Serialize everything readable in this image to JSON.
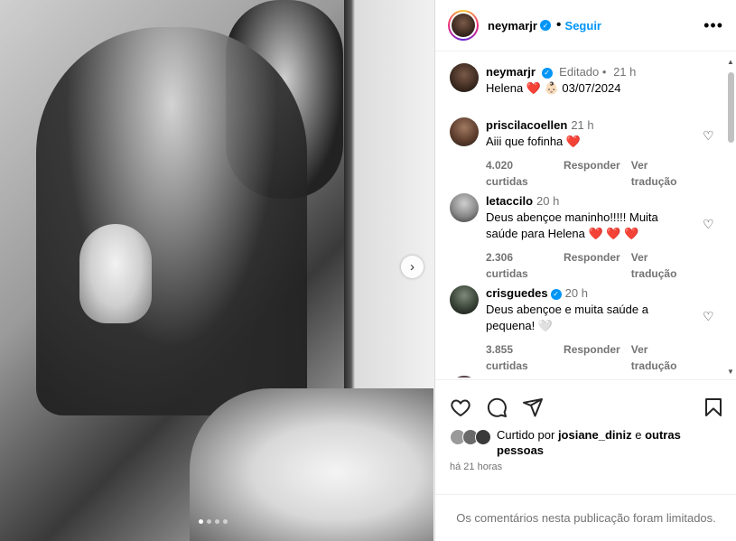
{
  "post": {
    "author": "neymarjr",
    "follow_label": "Seguir",
    "separator": "•",
    "more_label": "•••",
    "next_label": "›",
    "carousel_count": 4
  },
  "caption": {
    "username": "neymarjr",
    "edited": "Editado •",
    "time": "21 h",
    "text": "Helena ❤️ 👶🏻 03/07/2024"
  },
  "comments": [
    {
      "username": "priscilacoellen",
      "verified": false,
      "time": "21 h",
      "text": "Aiii que fofinha ❤️",
      "likes": "4.020 curtidas",
      "reply": "Responder",
      "translate": "Ver tradução"
    },
    {
      "username": "letaccilo",
      "verified": false,
      "time": "20 h",
      "text": "Deus abençoe maninho!!!!! Muita saúde para Helena ❤️ ❤️ ❤️",
      "likes": "2.306 curtidas",
      "reply": "Responder",
      "translate": "Ver tradução"
    },
    {
      "username": "crisguedes",
      "verified": true,
      "time": "20 h",
      "text": "Deus abençoe e muita saúde a pequena! 🤍",
      "likes": "3.855 curtidas",
      "reply": "Responder",
      "translate": "Ver tradução"
    }
  ],
  "likes_info": {
    "prefix": "Curtido por",
    "user": "josiane_diniz",
    "connector": "e",
    "others": "outras pessoas"
  },
  "timestamp": "há 21 horas",
  "footer": "Os comentários nesta publicação foram limitados.",
  "colors": {
    "accent": "#0095f6",
    "muted": "#737373",
    "heart_red": "#ed4956"
  }
}
